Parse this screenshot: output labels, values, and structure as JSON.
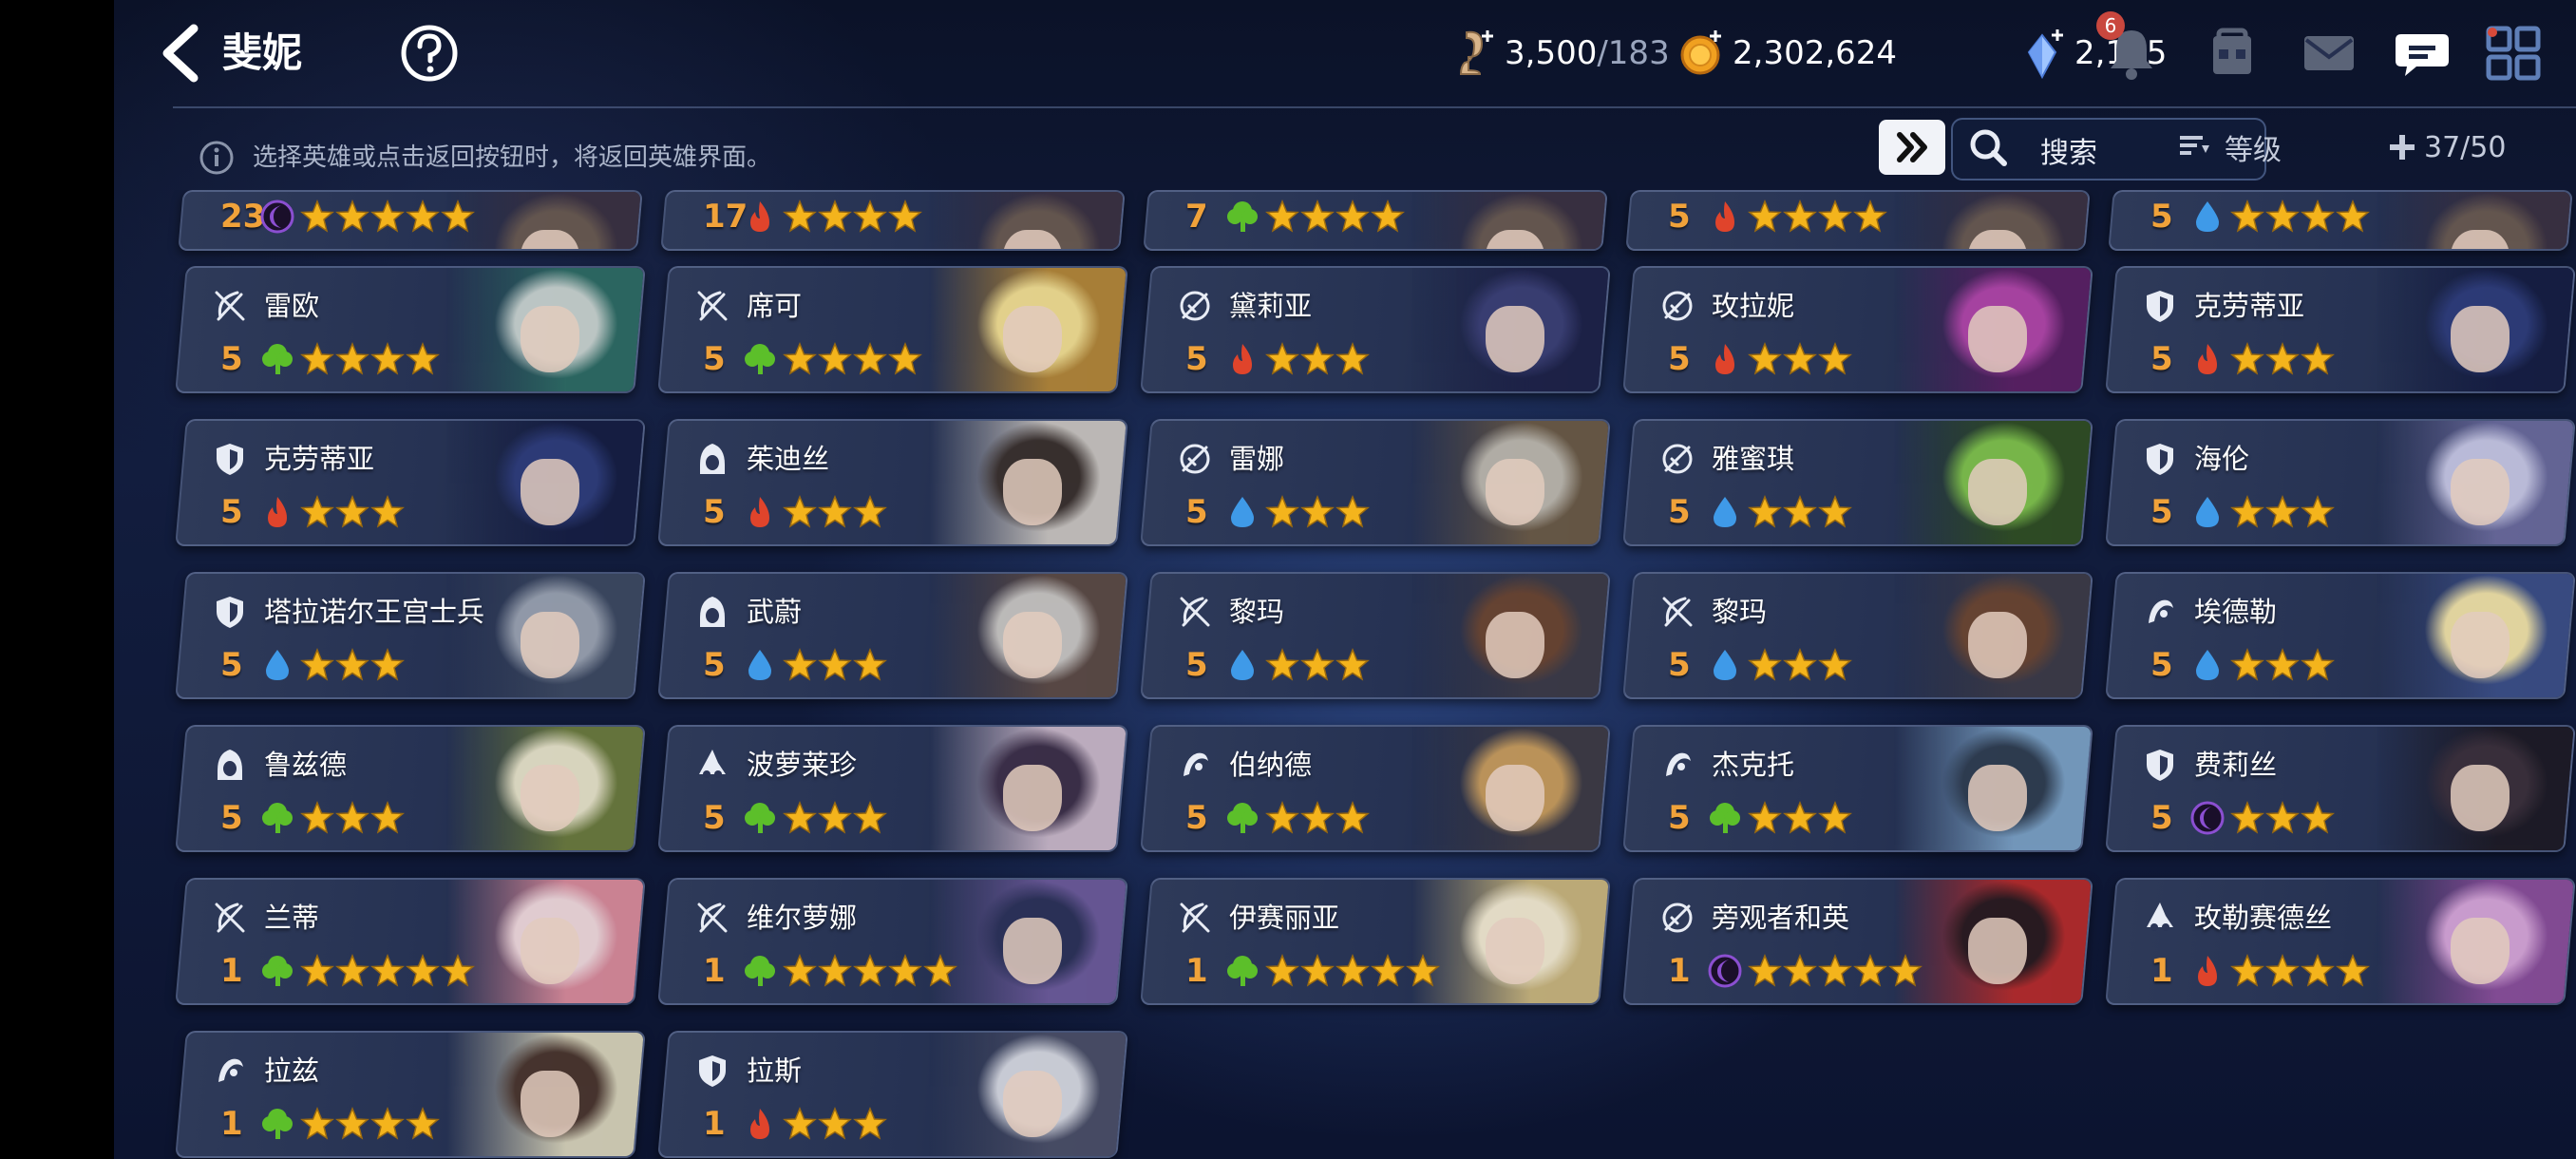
{
  "header": {
    "title": "斐妮",
    "currencies": [
      {
        "icon": "stamina-icon",
        "value": "3,500",
        "sub": "/183"
      },
      {
        "icon": "gold-coin-icon",
        "value": "2,302,624",
        "sub": ""
      },
      {
        "icon": "crystal-icon",
        "value": "2,195",
        "sub": ""
      }
    ],
    "notification_count": "6"
  },
  "toolbar": {
    "hint": "选择英雄或点击返回按钮时，将返回英雄界面。",
    "search_label": "搜索",
    "sort_label": "等级",
    "count": "37/50"
  },
  "colors": {
    "fire": "#e0442b",
    "water": "#3f9ae8",
    "nature": "#5cbf2a",
    "dark": "#8b4fd1",
    "star": "#f4b41c",
    "level": "#f0a23a"
  },
  "partial_row": [
    {
      "level": "23",
      "element": "dark",
      "stars": 5
    },
    {
      "level": "17",
      "element": "fire",
      "stars": 4
    },
    {
      "level": "7",
      "element": "nature",
      "stars": 4
    },
    {
      "level": "5",
      "element": "fire",
      "stars": 4
    },
    {
      "level": "5",
      "element": "water",
      "stars": 4
    }
  ],
  "heroes": [
    {
      "name": "雷欧",
      "level": "5",
      "element": "nature",
      "stars": 4,
      "class": "archer",
      "c1": "#c9d3cf",
      "c2": "#2d6b63"
    },
    {
      "name": "席可",
      "level": "5",
      "element": "nature",
      "stars": 4,
      "class": "archer",
      "c1": "#f3df91",
      "c2": "#b38637"
    },
    {
      "name": "黛莉亚",
      "level": "5",
      "element": "fire",
      "stars": 3,
      "class": "sword",
      "c1": "#3b3f75",
      "c2": "#1d2147"
    },
    {
      "name": "玫拉妮",
      "level": "5",
      "element": "fire",
      "stars": 3,
      "class": "sword",
      "c1": "#b145a8",
      "c2": "#5a1f63"
    },
    {
      "name": "克劳蒂亚",
      "level": "5",
      "element": "fire",
      "stars": 3,
      "class": "shield",
      "c1": "#2e3c7a",
      "c2": "#151d42"
    },
    {
      "name": "克劳蒂亚",
      "level": "5",
      "element": "fire",
      "stars": 3,
      "class": "shield",
      "c1": "#2e3c7a",
      "c2": "#151d42"
    },
    {
      "name": "茱迪丝",
      "level": "5",
      "element": "fire",
      "stars": 3,
      "class": "hood",
      "c1": "#3a302c",
      "c2": "#c9c4bf"
    },
    {
      "name": "雷娜",
      "level": "5",
      "element": "water",
      "stars": 3,
      "class": "sword",
      "c1": "#bdb8ad",
      "c2": "#6b5a45"
    },
    {
      "name": "雅蜜琪",
      "level": "5",
      "element": "water",
      "stars": 3,
      "class": "sword",
      "c1": "#7fc24a",
      "c2": "#2f4d22"
    },
    {
      "name": "海伦",
      "level": "5",
      "element": "water",
      "stars": 3,
      "class": "shield",
      "c1": "#c7c7e4",
      "c2": "#6a6a9c"
    },
    {
      "name": "塔拉诺尔王宫士兵",
      "level": "5",
      "element": "water",
      "stars": 3,
      "class": "shield",
      "c1": "#9aa2b0",
      "c2": "#3c4860"
    },
    {
      "name": "武蔚",
      "level": "5",
      "element": "water",
      "stars": 3,
      "class": "hood",
      "c1": "#c9c6c2",
      "c2": "#5c4a44"
    },
    {
      "name": "黎玛",
      "level": "5",
      "element": "water",
      "stars": 3,
      "class": "archer",
      "c1": "#6b4530",
      "c2": "#3c3a46"
    },
    {
      "name": "黎玛",
      "level": "5",
      "element": "water",
      "stars": 3,
      "class": "archer",
      "c1": "#6b4530",
      "c2": "#3c3a46"
    },
    {
      "name": "埃德勒",
      "level": "5",
      "element": "water",
      "stars": 3,
      "class": "mage",
      "c1": "#f1e2a6",
      "c2": "#3b4e86"
    },
    {
      "name": "鲁兹德",
      "level": "5",
      "element": "nature",
      "stars": 3,
      "class": "hood",
      "c1": "#e8e3c8",
      "c2": "#6b7a3c"
    },
    {
      "name": "波萝莱珍",
      "level": "5",
      "element": "nature",
      "stars": 3,
      "class": "witch",
      "c1": "#3d2f48",
      "c2": "#c9b7c8"
    },
    {
      "name": "伯纳德",
      "level": "5",
      "element": "nature",
      "stars": 3,
      "class": "mage",
      "c1": "#c89c5c",
      "c2": "#3d3a44"
    },
    {
      "name": "杰克托",
      "level": "5",
      "element": "nature",
      "stars": 3,
      "class": "mage",
      "c1": "#2f3d50",
      "c2": "#7aa0c4"
    },
    {
      "name": "费莉丝",
      "level": "5",
      "element": "dark",
      "stars": 3,
      "class": "shield",
      "c1": "#3b2f3a",
      "c2": "#1d1a24"
    },
    {
      "name": "兰蒂",
      "level": "1",
      "element": "nature",
      "stars": 5,
      "class": "archer",
      "c1": "#f1d9dc",
      "c2": "#d98a9a"
    },
    {
      "name": "维尔萝娜",
      "level": "1",
      "element": "nature",
      "stars": 5,
      "class": "archer",
      "c1": "#2c3158",
      "c2": "#6c5a9a"
    },
    {
      "name": "伊赛丽亚",
      "level": "1",
      "element": "nature",
      "stars": 5,
      "class": "archer",
      "c1": "#f3ead0",
      "c2": "#c9b57c"
    },
    {
      "name": "旁观者和英",
      "level": "1",
      "element": "dark",
      "stars": 5,
      "class": "sword",
      "c1": "#2a1a1e",
      "c2": "#b52a2a"
    },
    {
      "name": "玫勒赛德丝",
      "level": "1",
      "element": "fire",
      "stars": 4,
      "class": "witch",
      "c1": "#d7a5d8",
      "c2": "#8a4e9a"
    },
    {
      "name": "拉兹",
      "level": "1",
      "element": "nature",
      "stars": 4,
      "class": "mage",
      "c1": "#4a352c",
      "c2": "#d7d2b8"
    },
    {
      "name": "拉斯",
      "level": "1",
      "element": "fire",
      "stars": 3,
      "class": "shield",
      "c1": "#d6d8e0",
      "c2": "#4a4e66"
    }
  ]
}
